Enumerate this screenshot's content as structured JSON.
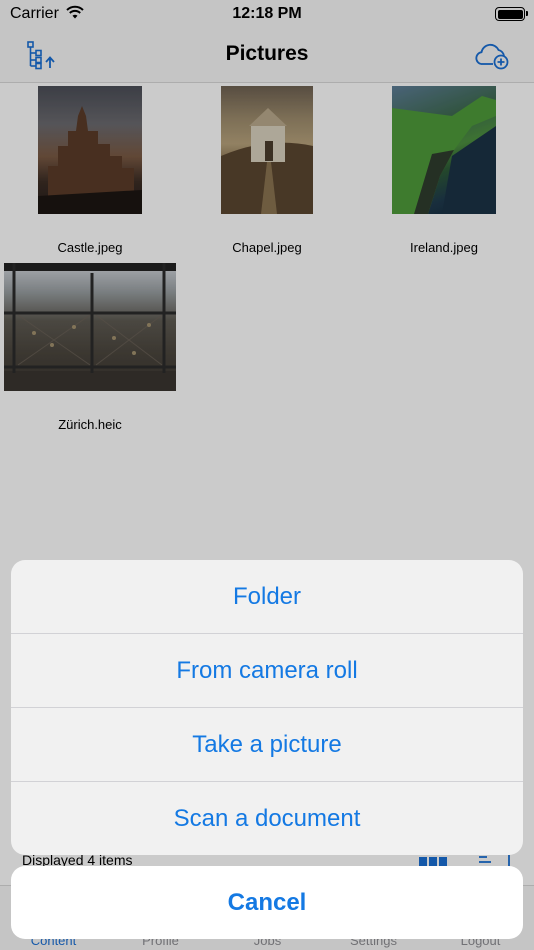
{
  "status_bar": {
    "carrier": "Carrier",
    "time": "12:18 PM"
  },
  "nav": {
    "title": "Pictures",
    "left_icon": "tree-upload-icon",
    "right_icon": "cloud-add-icon"
  },
  "files": [
    {
      "name": "Castle.jpeg"
    },
    {
      "name": "Chapel.jpeg"
    },
    {
      "name": "Ireland.jpeg"
    },
    {
      "name": "Zürich.heic"
    }
  ],
  "footer": {
    "status": "Displayed 4 items",
    "view_icons": [
      "grid-view-icon",
      "list-sort-icon"
    ]
  },
  "tabs": [
    {
      "label": "Content"
    },
    {
      "label": "Profile"
    },
    {
      "label": "Jobs"
    },
    {
      "label": "Settings"
    },
    {
      "label": "Logout"
    }
  ],
  "action_sheet": {
    "items": [
      {
        "label": "Folder"
      },
      {
        "label": "From camera roll"
      },
      {
        "label": "Take a picture"
      },
      {
        "label": "Scan a document"
      }
    ],
    "cancel_label": "Cancel"
  },
  "colors": {
    "accent": "#1479e3",
    "tab_active": "#1a6fd4"
  }
}
